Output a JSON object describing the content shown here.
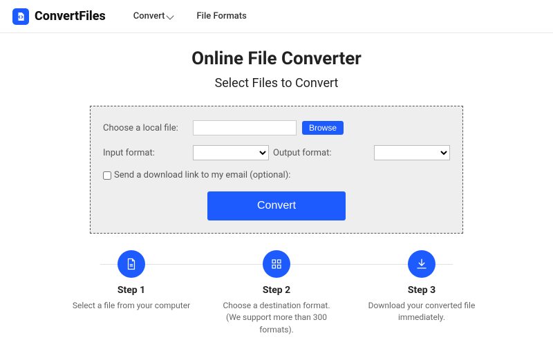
{
  "brand": "ConvertFiles",
  "nav": {
    "convert": "Convert",
    "formats": "File Formats"
  },
  "title": "Online File Converter",
  "subtitle": "Select Files to Convert",
  "panel": {
    "choose_label": "Choose a local file:",
    "browse_label": "Browse",
    "input_label": "Input format:",
    "output_label": "Output format:",
    "email_label": "Send a download link to my email (optional):",
    "convert_label": "Convert"
  },
  "steps": [
    {
      "title": "Step 1",
      "desc": "Select a file from your computer"
    },
    {
      "title": "Step 2",
      "desc": "Choose a destination format. (We support more than 300 formats)."
    },
    {
      "title": "Step 3",
      "desc": "Download your converted file immediately."
    }
  ]
}
